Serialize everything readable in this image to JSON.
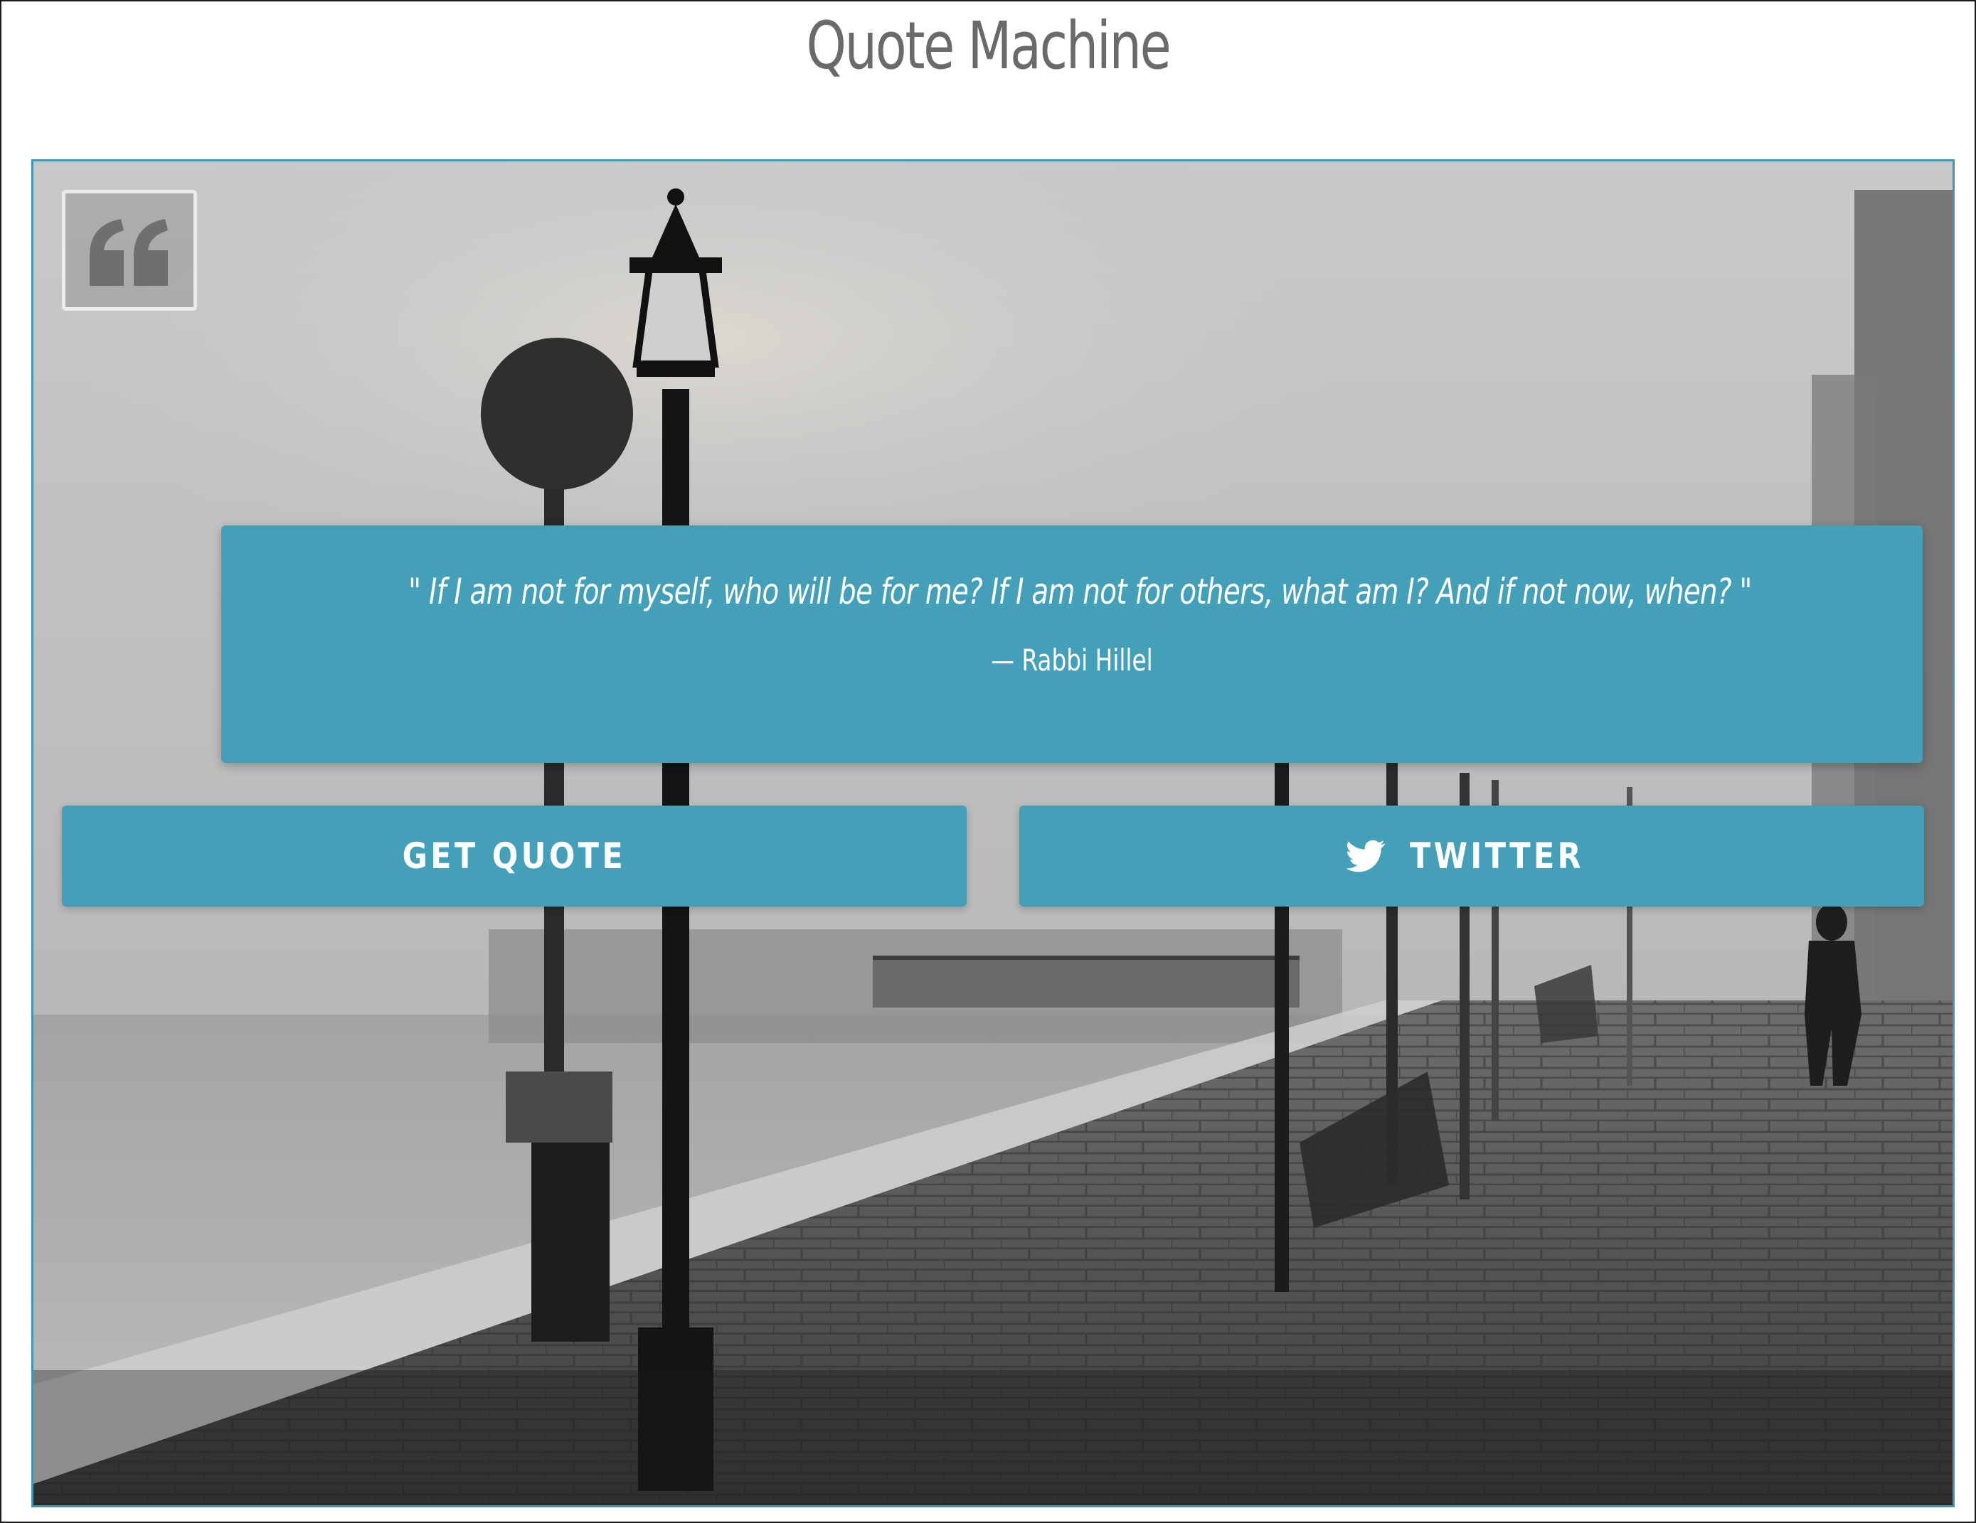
{
  "page": {
    "title": "Quote Machine"
  },
  "quote": {
    "text": "\" If I am not for myself, who will be for me? If I am not for others, what am I? And if not now, when? \"",
    "author": "— Rabbi Hillel"
  },
  "buttons": {
    "get_quote_label": "GET QUOTE",
    "twitter_label": "TWITTER"
  },
  "icons": {
    "quote": "quote-left-icon",
    "twitter": "twitter-bird-icon"
  },
  "colors": {
    "accent": "#449fb8",
    "border": "#3f98b2",
    "title": "#6a6a6a"
  }
}
